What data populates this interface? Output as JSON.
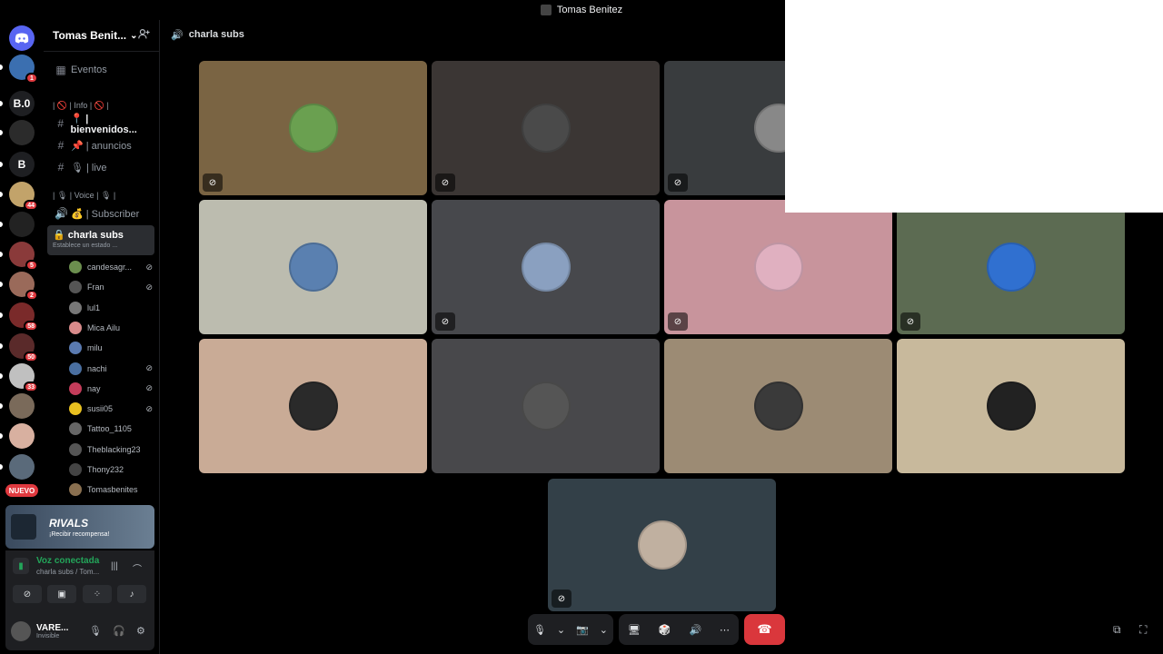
{
  "window": {
    "title": "Tomas Benitez"
  },
  "servers": [
    {
      "label": "",
      "color": "#5865f2",
      "badge": "",
      "icon": "discord-icon"
    },
    {
      "label": "",
      "color": "#3b6fb0",
      "badge": "1"
    },
    {
      "label": "B.0",
      "color": "#1e1f22",
      "badge": ""
    },
    {
      "label": "",
      "color": "#2b2b2b",
      "badge": ""
    },
    {
      "label": "B",
      "color": "#1e1f22",
      "badge": ""
    },
    {
      "label": "",
      "color": "#c2a36a",
      "badge": "44"
    },
    {
      "label": "",
      "color": "#222222",
      "badge": ""
    },
    {
      "label": "",
      "color": "#8a3a3a",
      "badge": "5"
    },
    {
      "label": "",
      "color": "#9a6a5a",
      "badge": "2"
    },
    {
      "label": "",
      "color": "#7a2a2a",
      "badge": "58"
    },
    {
      "label": "",
      "color": "#5a2a2a",
      "badge": "50"
    },
    {
      "label": "",
      "color": "#c0c0c0",
      "badge": "33"
    },
    {
      "label": "",
      "color": "#7a6a5a",
      "badge": ""
    },
    {
      "label": "",
      "color": "#d8b0a0",
      "badge": ""
    },
    {
      "label": "",
      "color": "#5a6a7a",
      "badge": ""
    }
  ],
  "nuevo_label": "NUEVO",
  "guild": {
    "name": "Tomas Benit...",
    "chevron": "⌄",
    "invite_icon": "add-member-icon"
  },
  "events_label": "Eventos",
  "categories": {
    "info": "| 🚫 | Info | 🚫 |",
    "voice": "| 🎙 | Voice | 🎙 |"
  },
  "channels": {
    "welcome": "📍 | bienvenidos...",
    "announce": "📌 | anuncios",
    "live": "🎙 | live",
    "subscriber": "💰 | Subscriber"
  },
  "active_voice": {
    "name": "charla subs",
    "status": "Establece un estado ..."
  },
  "members": [
    {
      "name": "candesagr...",
      "color": "#6b8e4e",
      "muted": true
    },
    {
      "name": "Fran",
      "color": "#555555",
      "muted": true
    },
    {
      "name": "lul1",
      "color": "#777777",
      "muted": false
    },
    {
      "name": "Mica Ailu",
      "color": "#d98b8b",
      "muted": false
    },
    {
      "name": "milu",
      "color": "#5a7ab0",
      "muted": false
    },
    {
      "name": "nachi",
      "color": "#4a6fa0",
      "muted": true
    },
    {
      "name": "nay",
      "color": "#c43c5a",
      "muted": true
    },
    {
      "name": "susii05",
      "color": "#e8c020",
      "muted": true
    },
    {
      "name": "Tattoo_1105",
      "color": "#666666",
      "muted": false
    },
    {
      "name": "Theblacking23",
      "color": "#555555",
      "muted": false
    },
    {
      "name": "Thony232",
      "color": "#444444",
      "muted": false
    },
    {
      "name": "Tomasbenites",
      "color": "#8a7050",
      "muted": false
    }
  ],
  "promo": {
    "logo": "RIVALS",
    "subtitle": "¡Recibir recompensa!"
  },
  "voice_panel": {
    "title": "Voz conectada",
    "subtitle": "charla subs / Tom..."
  },
  "user": {
    "name": "VARE...",
    "status": "Invisible"
  },
  "topbar": {
    "channel": "charla subs"
  },
  "tiles": [
    {
      "bg": "#7a6443",
      "avatar": "#6aa050",
      "muted": true
    },
    {
      "bg": "#3b3634",
      "avatar": "#4a4a4a",
      "muted": true
    },
    {
      "bg": "#393c3e",
      "avatar": "#888888",
      "muted": true
    },
    {
      "bg": "#bcbcaf",
      "avatar": "#5a80b0",
      "muted": false
    },
    {
      "bg": "#47484c",
      "avatar": "#8aa0c0",
      "muted": true
    },
    {
      "bg": "#c8949c",
      "avatar": "#e0b0c0",
      "muted": true
    },
    {
      "bg": "#5c6b52",
      "avatar": "#3070d0",
      "muted": true
    },
    {
      "bg": "#c9ab96",
      "avatar": "#2a2a2a",
      "muted": false
    },
    {
      "bg": "#48484b",
      "avatar": "#555555",
      "muted": false
    },
    {
      "bg": "#9c8b74",
      "avatar": "#3a3a3a",
      "muted": false
    },
    {
      "bg": "#c8b99c",
      "avatar": "#222222",
      "muted": false
    },
    {
      "bg": "#334048",
      "avatar": "#c0b0a0",
      "muted": true
    }
  ],
  "callbar": {
    "mic": "🎙",
    "cam": "📷",
    "share": "🖥",
    "activity": "🎲",
    "soundboard": "🔊",
    "more": "⋯",
    "end": "☎"
  },
  "colors": {
    "accent_green": "#23a55a",
    "end_call_red": "#da373c",
    "badge_red": "#e0393f"
  }
}
